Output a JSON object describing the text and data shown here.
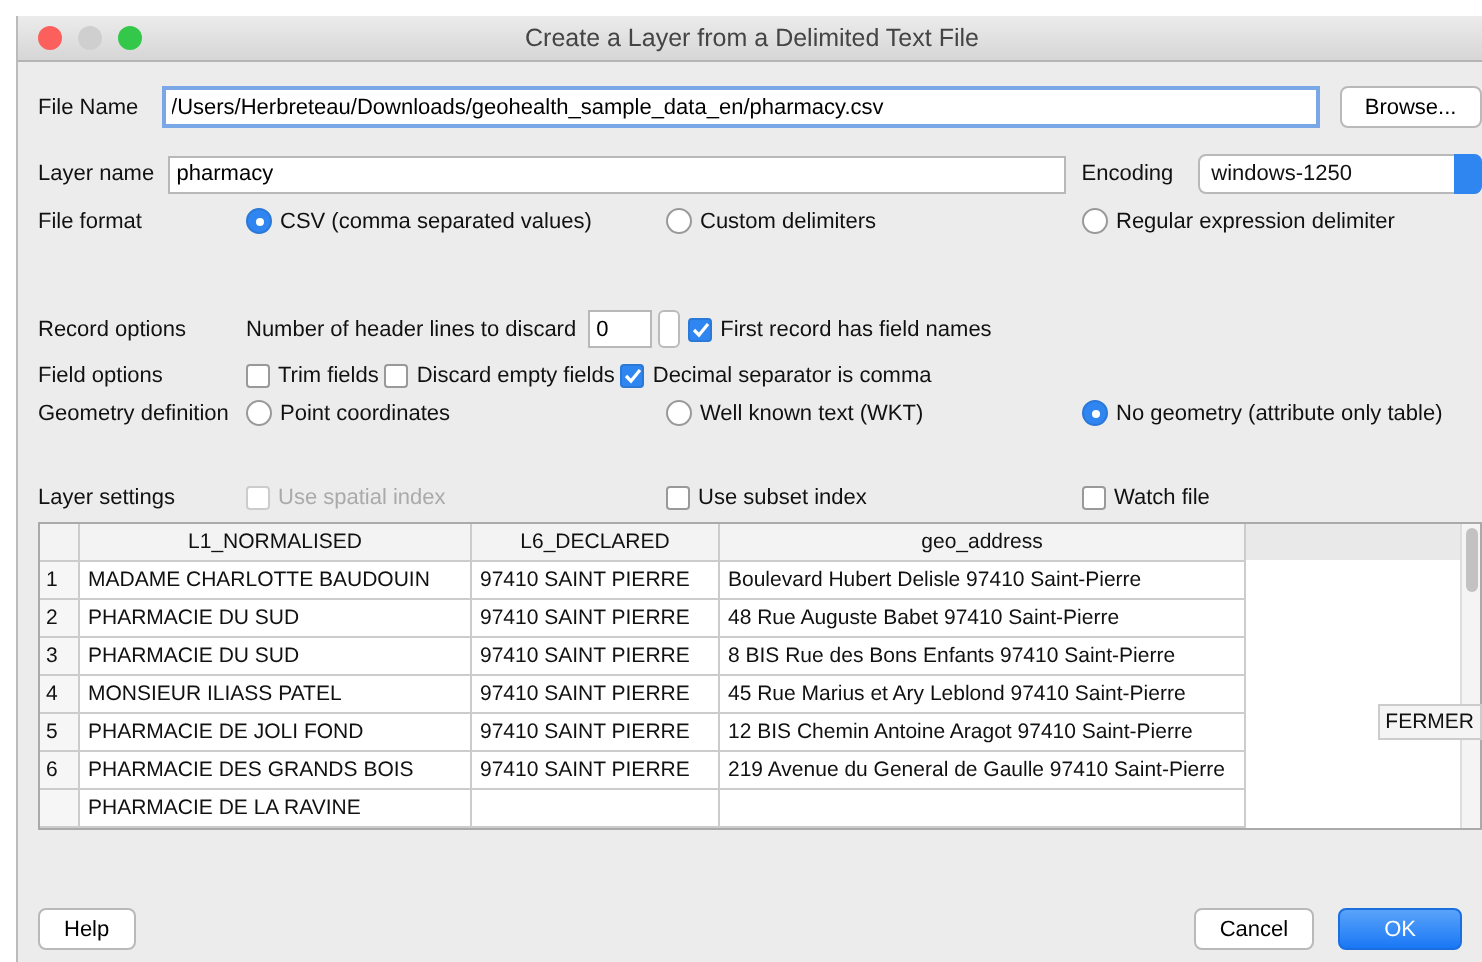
{
  "window": {
    "title": "Create a Layer from a Delimited Text File"
  },
  "file_name": {
    "label": "File Name",
    "value": "/Users/Herbreteau/Downloads/geohealth_sample_data_en/pharmacy.csv"
  },
  "browse_button": "Browse...",
  "layer_name": {
    "label": "Layer name",
    "value": "pharmacy"
  },
  "encoding": {
    "label": "Encoding",
    "value": "windows-1250"
  },
  "file_format": {
    "label": "File format",
    "options": [
      {
        "label": "CSV (comma separated values)",
        "selected": true
      },
      {
        "label": "Custom delimiters",
        "selected": false
      },
      {
        "label": "Regular expression delimiter",
        "selected": false
      }
    ]
  },
  "record_options": {
    "label": "Record options",
    "header_lines_label": "Number of header lines to discard",
    "header_lines_value": "0",
    "first_record": {
      "label": "First record has field names",
      "checked": true
    }
  },
  "field_options": {
    "label": "Field options",
    "options": [
      {
        "label": "Trim fields",
        "checked": false
      },
      {
        "label": "Discard empty fields",
        "checked": false
      },
      {
        "label": "Decimal separator is comma",
        "checked": true
      }
    ]
  },
  "geometry_definition": {
    "label": "Geometry definition",
    "options": [
      {
        "label": "Point coordinates",
        "selected": false
      },
      {
        "label": "Well known text (WKT)",
        "selected": false
      },
      {
        "label": "No geometry (attribute only table)",
        "selected": true
      }
    ]
  },
  "layer_settings": {
    "label": "Layer settings",
    "options": [
      {
        "label": "Use spatial index",
        "checked": false,
        "disabled": true
      },
      {
        "label": "Use subset index",
        "checked": false,
        "disabled": false
      },
      {
        "label": "Watch file",
        "checked": false,
        "disabled": false
      }
    ]
  },
  "table": {
    "columns": [
      "L1_NORMALISED",
      "L6_DECLARED",
      "geo_address"
    ],
    "rows": [
      {
        "index": "1",
        "cells": [
          "MADAME CHARLOTTE BAUDOUIN",
          "97410 SAINT PIERRE",
          "Boulevard Hubert Delisle 97410 Saint-Pierre"
        ]
      },
      {
        "index": "2",
        "cells": [
          "PHARMACIE DU SUD",
          "97410 SAINT PIERRE",
          "48 Rue Auguste Babet 97410 Saint-Pierre"
        ]
      },
      {
        "index": "3",
        "cells": [
          "PHARMACIE DU SUD",
          "97410 SAINT PIERRE",
          "8 BIS Rue des Bons Enfants 97410 Saint-Pierre"
        ]
      },
      {
        "index": "4",
        "cells": [
          "MONSIEUR ILIASS PATEL",
          "97410 SAINT PIERRE",
          "45 Rue Marius et Ary Leblond 97410 Saint-Pierre"
        ]
      },
      {
        "index": "5",
        "cells": [
          "PHARMACIE DE JOLI FOND",
          "97410 SAINT PIERRE",
          "12 BIS Chemin Antoine Aragot 97410 Saint-Pierre"
        ]
      },
      {
        "index": "6",
        "cells": [
          "PHARMACIE DES GRANDS BOIS",
          "97410 SAINT PIERRE",
          "219 Avenue du General de Gaulle 97410 Saint-Pierre"
        ]
      },
      {
        "cells": [
          "PHARMACIE DE LA RAVINE"
        ]
      }
    ]
  },
  "floating_button": "FERMER",
  "buttons": [
    {
      "label": "Help",
      "kind": "plain"
    },
    {
      "label": "Cancel",
      "kind": "plain"
    },
    {
      "label": "OK",
      "kind": "default"
    }
  ]
}
